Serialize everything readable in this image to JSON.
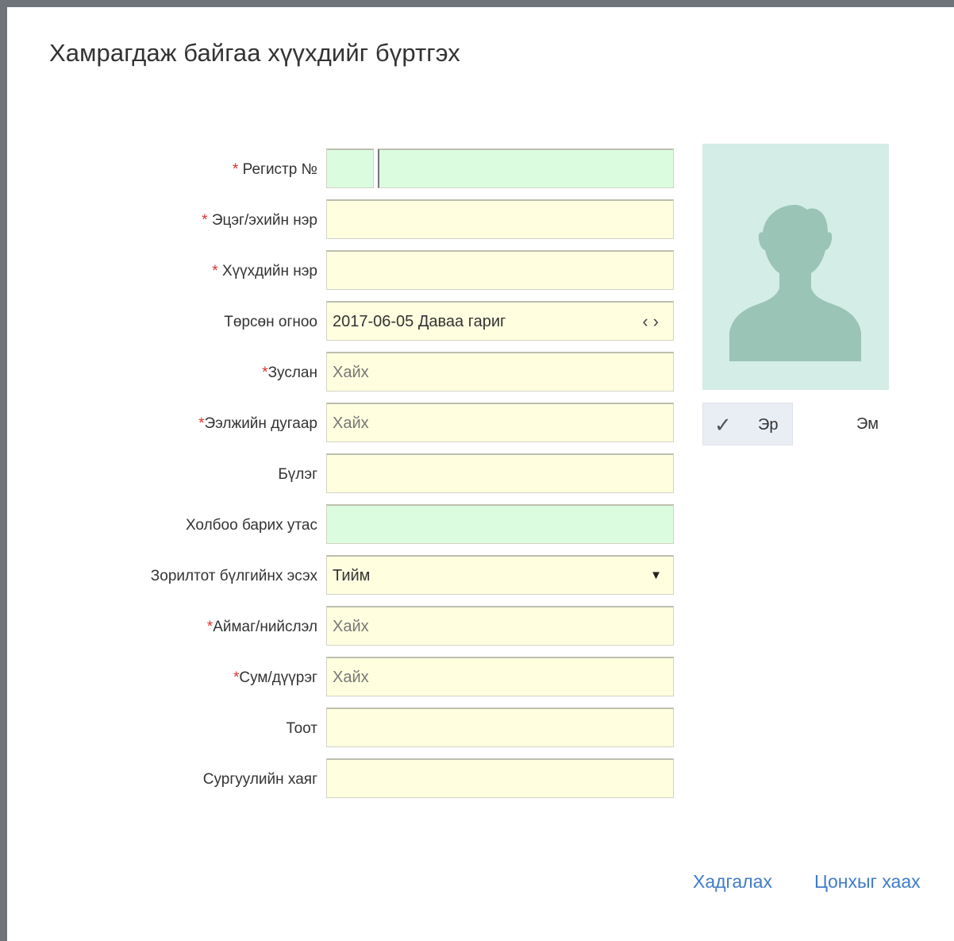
{
  "dialog": {
    "title": "Хамрагдаж байгаа хүүхдийг бүртгэх"
  },
  "form": {
    "register": {
      "required": "* ",
      "label": "Регистр №"
    },
    "parent_name": {
      "required": "* ",
      "label": "Эцэг/эхийн нэр",
      "value": ""
    },
    "child_name": {
      "required": "* ",
      "label": "Хүүхдийн нэр",
      "value": ""
    },
    "birth_date": {
      "label": "Төрсөн огноо",
      "value": "2017-06-05 Даваа гариг",
      "prev_glyph": "‹",
      "next_glyph": "›"
    },
    "group_name": {
      "required": "*",
      "label": "Зуслан",
      "placeholder": "Хайх"
    },
    "turn_number": {
      "required": "*",
      "label": "Ээлжийн дугаар",
      "placeholder": "Хайх"
    },
    "team": {
      "label": "Бүлэг",
      "value": ""
    },
    "phone": {
      "label": "Холбоо барих утас",
      "value": ""
    },
    "target_group": {
      "label": "Зорилтот бүлгийнх эсэх",
      "value": "Тийм",
      "caret": "▼"
    },
    "province": {
      "required": "*",
      "label": "Аймаг/нийслэл",
      "placeholder": "Хайх"
    },
    "district": {
      "required": "*",
      "label": "Сум/дүүрэг",
      "placeholder": "Хайх"
    },
    "door_no": {
      "label": "Тоот",
      "value": ""
    },
    "school_address": {
      "label": "Сургуулийн хаяг",
      "value": ""
    }
  },
  "avatar": {
    "icon": "person-silhouette-icon"
  },
  "gender": {
    "male_label": "Эр",
    "female_label": "Эм",
    "selected": "male",
    "check_glyph": "✓"
  },
  "footer": {
    "save_label": "Хадгалах",
    "close_label": "Цонхыг хаах"
  },
  "colors": {
    "required": "#e0322f",
    "field_yellow": "#ffffe0",
    "field_green": "#dbfcdf",
    "avatar_bg": "#d4ede6",
    "avatar_fg": "#9ac4b6",
    "link": "#3f7cc8"
  }
}
